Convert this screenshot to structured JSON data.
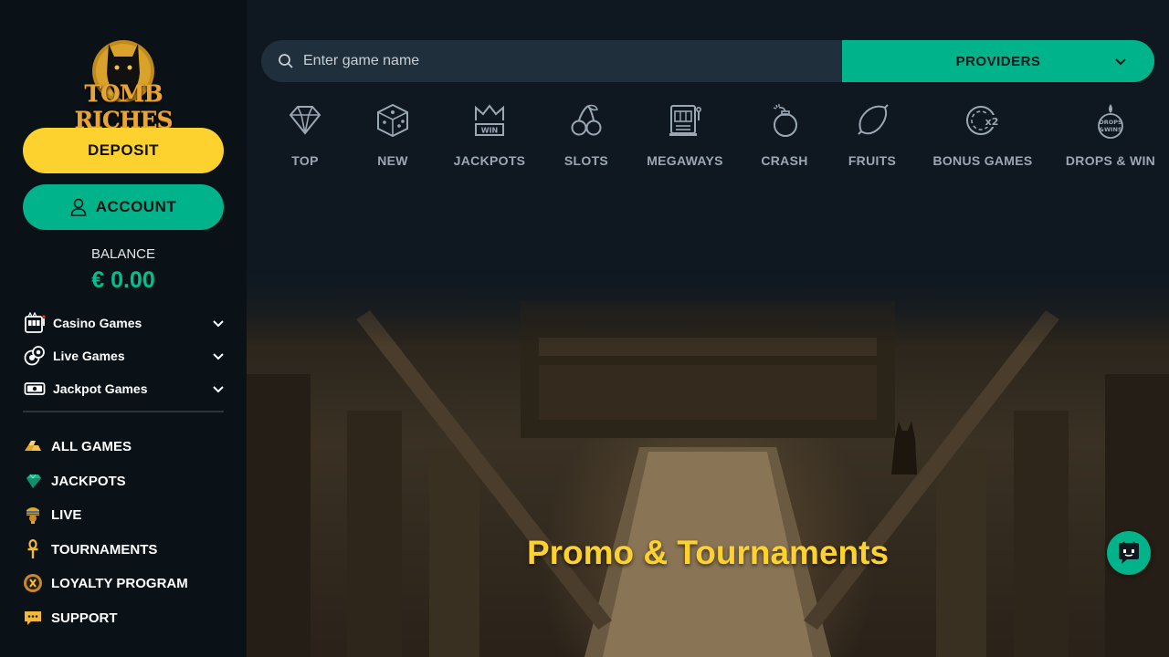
{
  "brand": {
    "logo_text": "TOMB RICHES"
  },
  "sidebar": {
    "deposit_label": "DEPOSIT",
    "account_label": "ACCOUNT",
    "balance_label": "BALANCE",
    "balance_value": "€ 0.00",
    "categories": [
      {
        "label": "Casino Games",
        "icon": "slot-machine-icon"
      },
      {
        "label": "Live Games",
        "icon": "chips-icon"
      },
      {
        "label": "Jackpot Games",
        "icon": "cash-icon"
      }
    ],
    "nav": [
      {
        "label": "ALL GAMES",
        "icon": "gold-bars-icon"
      },
      {
        "label": "JACKPOTS",
        "icon": "gem-icon"
      },
      {
        "label": "LIVE",
        "icon": "pharaoh-icon"
      },
      {
        "label": "TOURNAMENTS",
        "icon": "ankh-icon"
      },
      {
        "label": "LOYALTY PROGRAM",
        "icon": "loyalty-icon"
      },
      {
        "label": "SUPPORT",
        "icon": "chat-bubble-icon"
      }
    ]
  },
  "search": {
    "placeholder": "Enter game name"
  },
  "providers": {
    "label": "PROVIDERS"
  },
  "filters": [
    {
      "label": "TOP",
      "icon": "diamond-icon"
    },
    {
      "label": "NEW",
      "icon": "dice-icon"
    },
    {
      "label": "JACKPOTS",
      "icon": "crown-win-icon"
    },
    {
      "label": "SLOTS",
      "icon": "cherries-icon"
    },
    {
      "label": "MEGAWAYS",
      "icon": "slot-machine-icon"
    },
    {
      "label": "CRASH",
      "icon": "bomb-icon"
    },
    {
      "label": "FRUITS",
      "icon": "lemon-icon"
    },
    {
      "label": "BONUS GAMES",
      "icon": "bonus-x2-icon"
    },
    {
      "label": "DROPS & WIN",
      "icon": "drops-wins-icon"
    }
  ],
  "hero": {
    "title": "Promo & Tournaments"
  },
  "colors": {
    "accent_green": "#00b38a",
    "accent_yellow": "#fdd22e",
    "background": "#0f1821",
    "sidebar": "#0a1218"
  }
}
